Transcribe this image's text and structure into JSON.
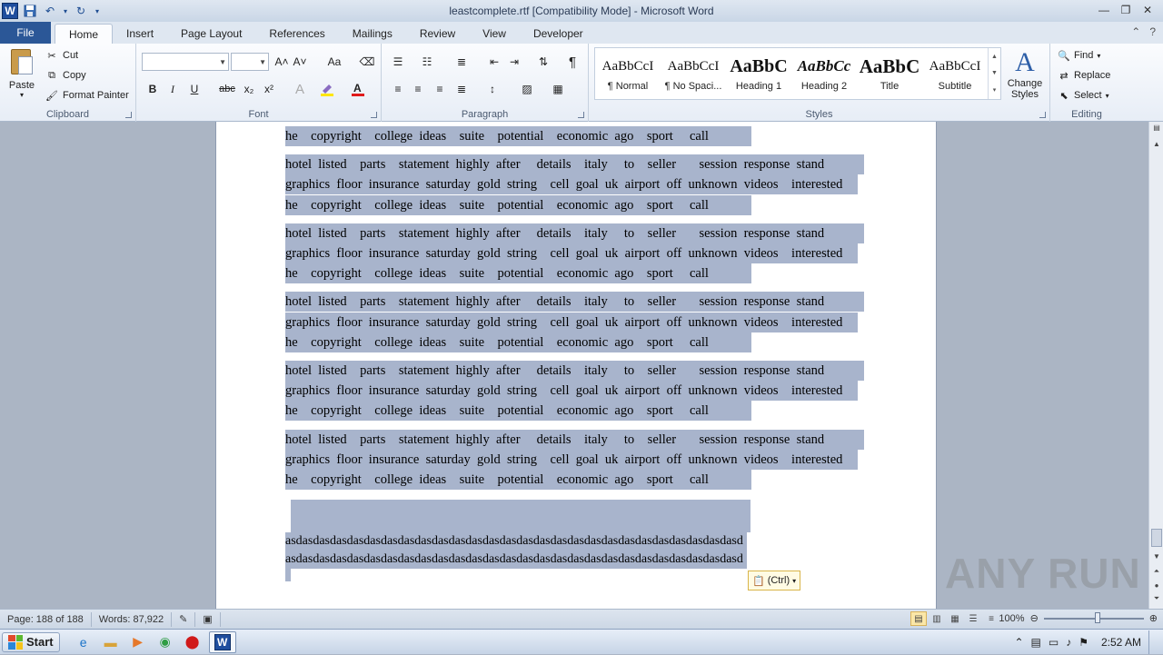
{
  "window": {
    "title": "leastcomplete.rtf [Compatibility Mode]  -  Microsoft Word",
    "app_icon": "W"
  },
  "tabs": [
    {
      "label": "File"
    },
    {
      "label": "Home"
    },
    {
      "label": "Insert"
    },
    {
      "label": "Page Layout"
    },
    {
      "label": "References"
    },
    {
      "label": "Mailings"
    },
    {
      "label": "Review"
    },
    {
      "label": "View"
    },
    {
      "label": "Developer"
    }
  ],
  "clipboard": {
    "paste": "Paste",
    "cut": "Cut",
    "copy": "Copy",
    "format_painter": "Format Painter",
    "group": "Clipboard"
  },
  "font": {
    "name": "",
    "size": "",
    "group": "Font",
    "bold": "B",
    "italic": "I",
    "underline": "U",
    "strike": "abc",
    "sub": "x₂",
    "sup": "x²",
    "grow": "A˄",
    "shrink": "A˅",
    "case": "Aa"
  },
  "paragraph": {
    "group": "Paragraph",
    "pilcrow": "¶"
  },
  "styles": {
    "group": "Styles",
    "items": [
      {
        "preview": "AaBbCcI",
        "name": "¶ Normal"
      },
      {
        "preview": "AaBbCcI",
        "name": "¶ No Spaci..."
      },
      {
        "preview": "AaBbC",
        "name": "Heading 1"
      },
      {
        "preview": "AaBbCc",
        "name": "Heading 2"
      },
      {
        "preview": "AaBbC",
        "name": "Title"
      },
      {
        "preview": "AaBbCcI",
        "name": "Subtitle"
      }
    ],
    "change": "Change Styles"
  },
  "editing": {
    "group": "Editing",
    "find": "Find",
    "replace": "Replace",
    "select": "Select"
  },
  "document": {
    "lines": [
      {
        "text": "he    copyright    college  ideas    suite    potential    economic  ago    sport     call",
        "w": 513
      },
      {
        "text": "hotel  listed    parts    statement  highly  after     details    italy     to    seller       session  response  stand",
        "w": 637
      },
      {
        "text": "graphics  floor  insurance  saturday  gold  string    cell  goal  uk  airport  off  unknown  videos    interested",
        "w": 630
      },
      {
        "text": "he    copyright    college  ideas    suite    potential    economic  ago    sport     call",
        "w": 513
      },
      {
        "text": "hotel  listed    parts    statement  highly  after     details    italy     to    seller       session  response  stand",
        "w": 637
      },
      {
        "text": "graphics  floor  insurance  saturday  gold  string    cell  goal  uk  airport  off  unknown  videos    interested",
        "w": 630
      },
      {
        "text": "he    copyright    college  ideas    suite    potential    economic  ago    sport     call",
        "w": 513
      },
      {
        "text": "hotel  listed    parts    statement  highly  after     details    italy     to    seller       session  response  stand",
        "w": 637
      },
      {
        "text": "graphics  floor  insurance  saturday  gold  string    cell  goal  uk  airport  off  unknown  videos    interested",
        "w": 630
      },
      {
        "text": "he    copyright    college  ideas    suite    potential    economic  ago    sport     call",
        "w": 513
      },
      {
        "text": "hotel  listed    parts    statement  highly  after     details    italy     to    seller       session  response  stand",
        "w": 637
      },
      {
        "text": "graphics  floor  insurance  saturday  gold  string    cell  goal  uk  airport  off  unknown  videos    interested",
        "w": 630
      },
      {
        "text": "he    copyright    college  ideas    suite    potential    economic  ago    sport     call",
        "w": 513
      },
      {
        "text": "hotel  listed    parts    statement  highly  after     details    italy     to    seller       session  response  stand",
        "w": 637
      },
      {
        "text": "graphics  floor  insurance  saturday  gold  string    cell  goal  uk  airport  off  unknown  videos    interested",
        "w": 630
      },
      {
        "text": "he    copyright    college  ideas    suite    potential    economic  ago    sport     call",
        "w": 513
      }
    ],
    "asd_lines": [
      "asdasdasdasdasdasdasdasdasdasdasdasdasdasdasdasdasdasdasdasdasdasdasdasdasdasdasd",
      "asdasdasdasdasdasdasdasdasdasdasdasdasdasdasdasdasdasdasdasdasdasdasdasdasdasdasd"
    ]
  },
  "paste_options": "(Ctrl)",
  "watermark": "ANY RUN",
  "status": {
    "page": "Page: 188 of 188",
    "words": "Words: 87,922",
    "zoom": "100%"
  },
  "taskbar": {
    "start": "Start",
    "clock": "2:52 AM"
  },
  "colors": {
    "selection": "#a8b4cc",
    "file_tab": "#2b5797"
  }
}
